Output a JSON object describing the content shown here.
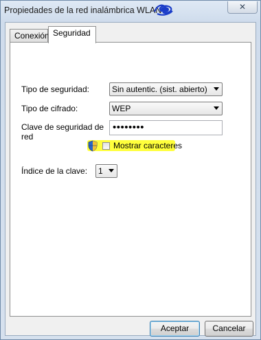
{
  "window": {
    "title": "Propiedades de la red inalámbrica WLAN",
    "close_glyph": "✕"
  },
  "tabs": [
    {
      "label": "Conexión",
      "active": false
    },
    {
      "label": "Seguridad",
      "active": true
    }
  ],
  "security": {
    "type_label": "Tipo de seguridad:",
    "type_value": "Sin autentic. (sist. abierto)",
    "cipher_label": "Tipo de cifrado:",
    "cipher_value": "WEP",
    "key_label_line1": "Clave de seguridad de",
    "key_label_line2": "red",
    "key_value": "••••••••",
    "show_chars_label": "Mostrar caracteres",
    "show_chars_checked": false,
    "index_label": "Índice de la clave:",
    "index_value": "1"
  },
  "buttons": {
    "ok": "Aceptar",
    "cancel": "Cancelar"
  },
  "colors": {
    "highlight": "#ffff3c",
    "scribble": "#1a3cc8"
  },
  "icons": {
    "shield": "uac-shield-icon",
    "scribble": "blue-scribble-annotation"
  }
}
